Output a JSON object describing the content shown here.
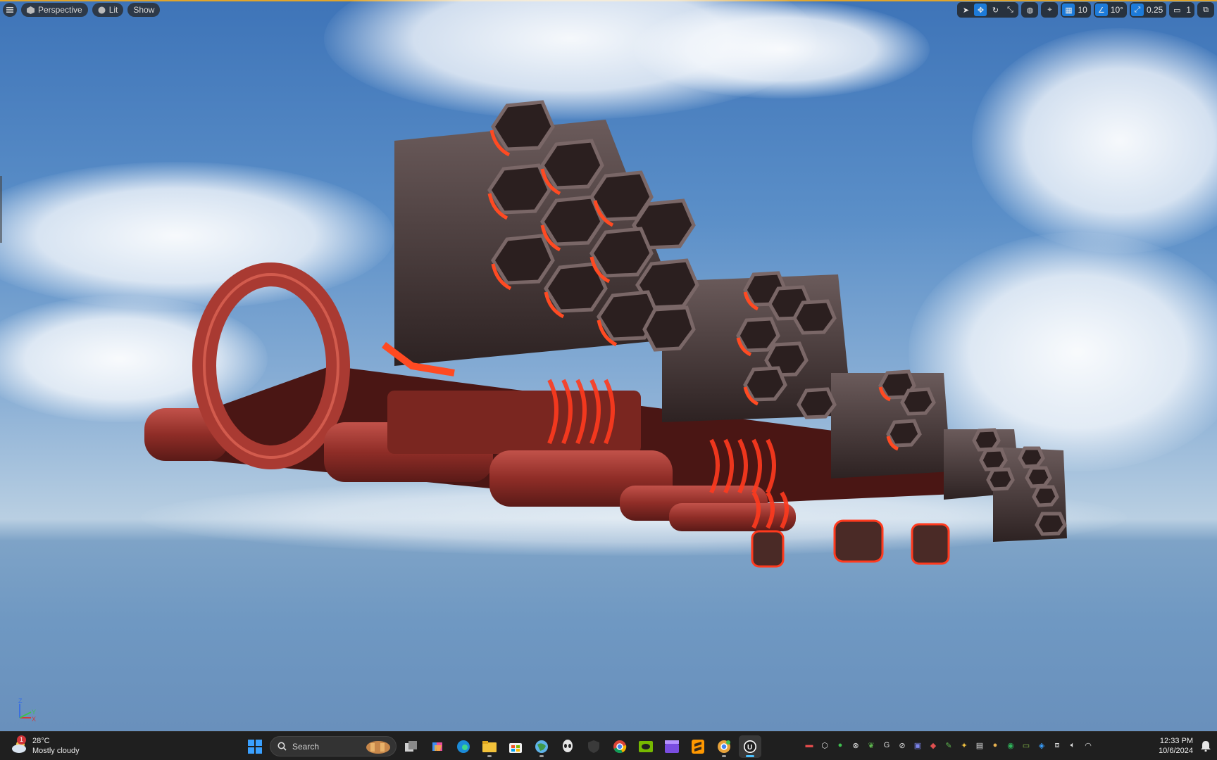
{
  "viewport": {
    "toolbar_left": {
      "perspective_label": "Perspective",
      "lit_label": "Lit",
      "show_label": "Show"
    },
    "toolbar_right": {
      "grid_snap_value": "10",
      "rotation_snap_value": "10°",
      "scale_snap_value": "0.25",
      "camera_speed_value": "1"
    },
    "axis_labels": {
      "z": "Z",
      "x": "X",
      "y": "Y"
    }
  },
  "taskbar": {
    "weather": {
      "temperature": "28°C",
      "condition": "Mostly cloudy",
      "alert_count": "1"
    },
    "search_placeholder": "Search",
    "clock": {
      "time": "12:33 PM",
      "date": "10/6/2024"
    },
    "apps": [
      "start-icon",
      "search",
      "task-view-icon",
      "copilot-icon",
      "edge-icon",
      "file-explorer-icon",
      "microsoft-store-icon",
      "browser-globe-icon",
      "alienware-icon",
      "shield-icon",
      "chrome-icon",
      "nvidia-icon",
      "clapper-icon",
      "sublime-text-icon",
      "chrome-canary-icon",
      "unreal-engine-icon"
    ]
  },
  "colors": {
    "active_blue": "#1d7bd9",
    "ship_glow": "#ff3a1e",
    "viewport_border": "#e0a52b"
  }
}
